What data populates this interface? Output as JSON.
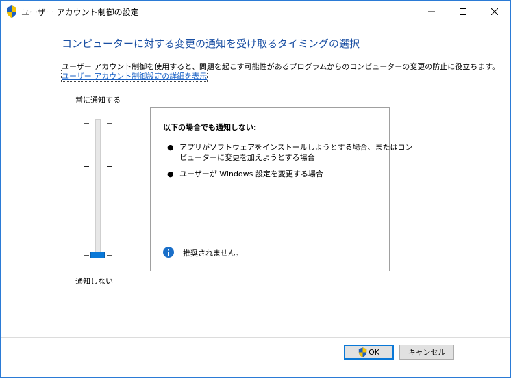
{
  "window": {
    "title": "ユーザー アカウント制御の設定"
  },
  "main": {
    "heading": "コンピューターに対する変更の通知を受け取るタイミングの選択",
    "description": "ユーザー アカウント制御を使用すると、問題を起こす可能性があるプログラムからのコンピューターの変更の防止に役立ちます。",
    "link": "ユーザー アカウント制御設定の詳細を表示"
  },
  "slider": {
    "top_label": "常に通知する",
    "bottom_label": "通知しない",
    "levels": 4,
    "selected_level": 1
  },
  "info": {
    "heading": "以下の場合でも通知しない:",
    "bullets": [
      {
        "line1": "アプリがソフトウェアをインストールしようとする場合、またはコン",
        "line2": "ピューターに変更を加えようとする場合"
      },
      {
        "line1": "ユーザーが Windows 設定を変更する場合",
        "line2": ""
      }
    ],
    "note": "推奨されません。"
  },
  "buttons": {
    "ok": "OK",
    "cancel": "キャンセル"
  },
  "colors": {
    "accent": "#0a78d7",
    "heading": "#1a4fa3",
    "link": "#1a62c6"
  }
}
